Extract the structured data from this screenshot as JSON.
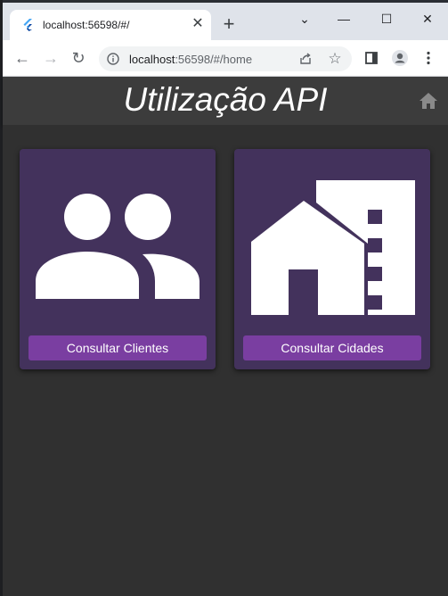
{
  "browser": {
    "tab_title": "localhost:56598/#/",
    "tab_close": "✕",
    "new_tab": "+",
    "url_host": "localhost",
    "url_rest": ":56598/#/home",
    "controls": {
      "minimize": "—",
      "maximize": "☐",
      "close": "✕",
      "chevron": "⌄"
    },
    "nav": {
      "back": "←",
      "forward": "→",
      "reload": "↻"
    },
    "star": "☆"
  },
  "app": {
    "title": "Utilização API",
    "cards": [
      {
        "label": "Consultar Clientes",
        "icon": "people-icon"
      },
      {
        "label": "Consultar Cidades",
        "icon": "city-house-icon"
      }
    ],
    "colors": {
      "appbar": "#3c3c3c",
      "background": "#303030",
      "card": "#43325c",
      "button": "#7a3ea1"
    }
  }
}
